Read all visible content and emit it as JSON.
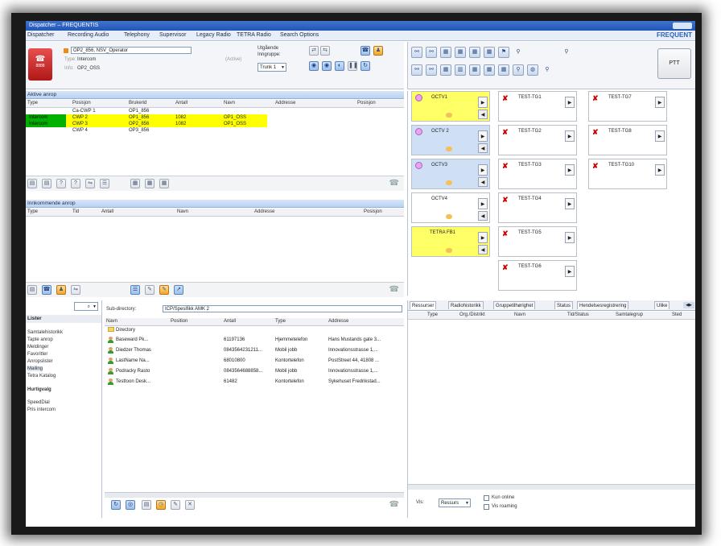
{
  "titlebar": {
    "title": "Dispatcher – FREQUENTIS"
  },
  "menu": {
    "items": [
      "Dispatcher",
      "Recording Audio",
      "Telephony",
      "Supervisor",
      "Legacy Radio",
      "TETRA Radio",
      "Search Options"
    ],
    "brand": "FREQUENT"
  },
  "callbox": {
    "caller": "OP2_856, NSV_Operator",
    "type_label": "Type:",
    "type_value": "Intercom",
    "info_label": "Info:",
    "info_value": "OP2_OSS",
    "status": "(Active)",
    "end_label": "8888",
    "outgoing_label": "Utgående",
    "outgoing_group_label": "Inngruppe:",
    "trunk_value": "Trunk 1"
  },
  "active_calls": {
    "title": "Aktive anrop",
    "columns": [
      "Type",
      "Posisjon",
      "Brukerid",
      "Antall",
      "Navn",
      "Addresse",
      "Posisjon"
    ],
    "rows": [
      {
        "type": "",
        "posisjon": "Ca-CWP 1",
        "brukerid": "OP1_856",
        "antall": "",
        "navn": ""
      },
      {
        "type": "Intercom",
        "posisjon": "CWP 2",
        "brukerid": "OP1_856",
        "antall": "1082",
        "navn": "OP1_OSS"
      },
      {
        "type": "Intercom",
        "posisjon": "CWP 3",
        "brukerid": "OP2_856",
        "antall": "1082",
        "navn": "OP1_OSS"
      },
      {
        "type": "",
        "posisjon": "CWP 4",
        "brukerid": "OP3_856",
        "antall": "",
        "navn": ""
      }
    ]
  },
  "incoming_calls": {
    "title": "Innkommende anrop",
    "columns": [
      "Type",
      "Tid",
      "Antall",
      "Navn",
      "Addresse",
      "Posisjon"
    ]
  },
  "lists": {
    "title": "Lister",
    "items": [
      "Samtalehistorikk",
      "Tapte anrop",
      "Meldinger",
      "Favoritter",
      "Anropslister",
      "Mailing",
      "Tetra Katalog"
    ],
    "shortcuts_title": "Hurtigvalg",
    "shortcuts": [
      "SpeedDial",
      "Pris intercom"
    ]
  },
  "directory": {
    "sub_label": "Sub-directory:",
    "sub_value": "ICP/Spesifikk AMK 2",
    "columns": [
      "Navn",
      "Position",
      "Antall",
      "Type",
      "Addresse"
    ],
    "folder": "Directory",
    "rows": [
      {
        "navn": "Baseward Pk...",
        "position": "",
        "antall": "61197136",
        "type": "Hjemmetelefon",
        "addresse": "Hans Mustands gate 3..."
      },
      {
        "navn": "Diedzer Thomas",
        "position": "",
        "antall": "0843564231211...",
        "type": "Mobil jobb",
        "addresse": "Innovationsstrasse 1,..."
      },
      {
        "navn": "LastName Na...",
        "position": "",
        "antall": "68010800",
        "type": "Kontortelefon",
        "addresse": "PostStreet 44, 41808 ..."
      },
      {
        "navn": "Podracky Rasto",
        "position": "",
        "antall": "0843564688858...",
        "type": "Mobil jobb",
        "addresse": "Innovationsstrasse 1,..."
      },
      {
        "navn": "Testtoon Desk...",
        "position": "",
        "antall": "61482",
        "type": "Kontortelefon",
        "addresse": "Sykehuset Fredrikstad..."
      }
    ]
  },
  "talkgroups": {
    "ptt_label": "PTT",
    "tiles": [
      {
        "name": "OCTV1",
        "style": "yel",
        "mark": "icon"
      },
      {
        "name": "TEST-TG1",
        "style": "white",
        "mark": "x"
      },
      {
        "name": "TEST-TG7",
        "style": "white",
        "mark": "x"
      },
      {
        "name": "OCTV 2",
        "style": "blue",
        "mark": "icon"
      },
      {
        "name": "TEST-TG2",
        "style": "white",
        "mark": "x"
      },
      {
        "name": "TEST-TG8",
        "style": "white",
        "mark": "x"
      },
      {
        "name": "OCTV3",
        "style": "blue",
        "mark": "icon"
      },
      {
        "name": "TEST-TG3",
        "style": "white",
        "mark": "x"
      },
      {
        "name": "TEST-TG10",
        "style": "white",
        "mark": "x"
      },
      {
        "name": "OCTV4",
        "style": "white",
        "mark": "none"
      },
      {
        "name": "TEST-TG4",
        "style": "white",
        "mark": "x"
      },
      {
        "name": "TETRA FB1",
        "style": "yel",
        "mark": "none"
      },
      {
        "name": "TEST-TG5",
        "style": "white",
        "mark": "x"
      },
      {
        "name": "TEST-TG6",
        "style": "white",
        "mark": "x"
      }
    ]
  },
  "resources": {
    "tabs": [
      "Ressurser",
      "Radiohistorikk",
      "Gruppetilhørighet",
      "Status",
      "Hendelsesregistrering",
      "Ulike"
    ],
    "columns": [
      "Type",
      "Org./Distrikt",
      "Navn",
      "Tid/Status",
      "Samtalegrup",
      "Sted"
    ],
    "vis_label": "Vis:",
    "vis_value": "Ressurs",
    "check_online": "Kun online",
    "check_roaming": "Vis roaming"
  }
}
